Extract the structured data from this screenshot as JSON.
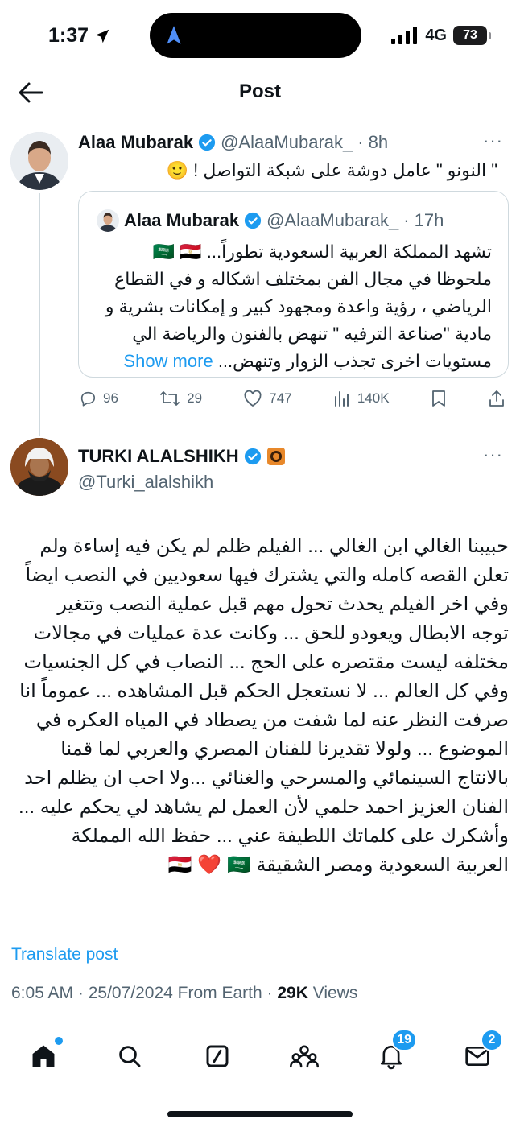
{
  "status_bar": {
    "time": "1:37",
    "network": "4G",
    "battery": "73"
  },
  "header": {
    "title": "Post"
  },
  "tweet1": {
    "name": "Alaa Mubarak",
    "handle": "@AlaaMubarak_",
    "time": "8h",
    "text": "\" النونو \" عامل دوشة على شبكة التواصل ! 🙂",
    "quote": {
      "name": "Alaa Mubarak",
      "handle": "@AlaaMubarak_",
      "time": "17h",
      "text": "تشهد المملكة العربية السعودية تطوراً... 🇸🇦 🇪🇬 ملحوظا في مجال الفن بمختلف اشكاله و في القطاع الرياضي ، رؤية واعدة ومجهود كبير و إمكانات بشرية و مادية \"صناعة الترفيه \" تنهض بالفنون والرياضة الي مستويات اخرى تجذب الزوار وتنهض...",
      "show_more": "Show more"
    },
    "actions": {
      "replies": "96",
      "reposts": "29",
      "likes": "747",
      "views": "140K"
    }
  },
  "tweet2": {
    "name": "TURKI ALALSHIKH",
    "handle": "@Turki_alalshikh",
    "text": "حبيبنا الغالي ابن الغالي ... الفيلم ظلم لم يكن فيه إساءة ولم تعلن القصه كامله والتي يشترك فيها سعوديين في النصب ايضاً وفي اخر الفيلم يحدث تحول مهم قبل عملية النصب وتتغير توجه الابطال ويعودو للحق ... وكانت عدة عمليات في مجالات مختلفه ليست مقتصره على الحج ... النصاب في كل الجنسيات وفي كل العالم ... لا نستعجل الحكم قبل المشاهده ... عموماً انا صرفت النظر عنه لما شفت من يصطاد في المياه العكره في الموضوع ... ولولا تقديرنا للفنان المصري والعربي لما قمنا بالانتاج السينمائي والمسرحي والغنائي ...ولا احب ان يظلم احد الفنان العزيز احمد حلمي لأن العمل لم يشاهد لي يحكم عليه ... وأشكرك على كلماتك اللطيفة عني ... حفظ الله المملكة العربية السعودية ومصر الشقيقة 🇪🇬 ❤️ 🇸🇦",
    "translate": "Translate post",
    "meta_time": "6:05 AM · 25/07/2024 From Earth · ",
    "views_count": "29K",
    "views_label": " Views"
  },
  "bottom_nav": {
    "notifications_badge": "19",
    "messages_badge": "2"
  },
  "colors": {
    "accent": "#1d9bf0",
    "verified": "#1d9bf0",
    "secondary_text": "#536471",
    "affiliate_badge": "#e8882a"
  }
}
